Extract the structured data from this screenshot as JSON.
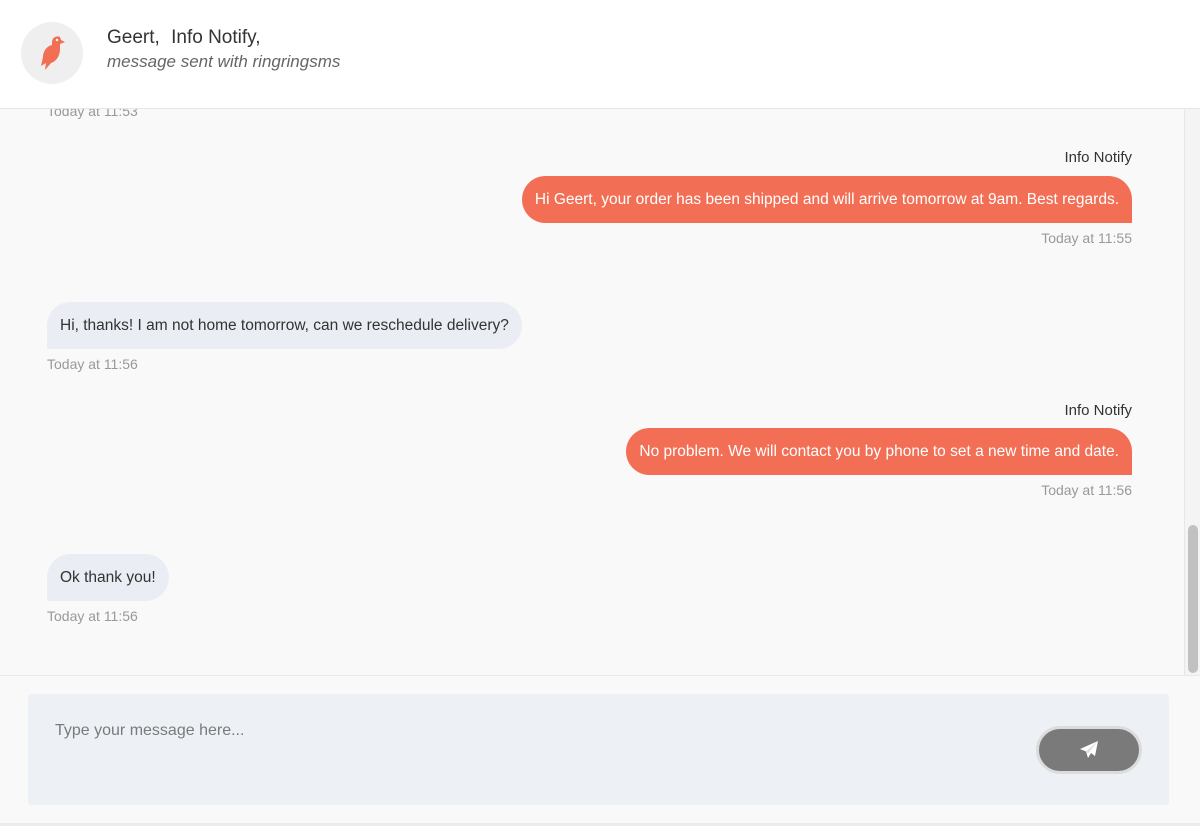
{
  "header": {
    "participants": [
      "Geert,",
      "Info Notify,"
    ],
    "subtitle": "message sent with ringringsms",
    "avatar_icon": "bird-icon",
    "brand_color": "#f26f55"
  },
  "conversation": {
    "top_partial_timestamp": "Today at 11:53",
    "messages": [
      {
        "direction": "out",
        "sender": "Info Notify",
        "text": "Hi Geert, your order has been shipped and will arrive tomorrow at 9am. Best regards.",
        "time": "Today at 11:55"
      },
      {
        "direction": "in",
        "text": "Hi, thanks! I am not home tomorrow, can we reschedule delivery?",
        "time": "Today at 11:56"
      },
      {
        "direction": "out",
        "sender": "Info Notify",
        "text": "No problem. We will contact you by phone to set a new time and date.",
        "time": "Today at 11:56"
      },
      {
        "direction": "in",
        "text": "Ok thank you!",
        "time": "Today at 11:56"
      }
    ]
  },
  "composer": {
    "placeholder": "Type your message here...",
    "value": "",
    "send_icon": "paper-plane-icon"
  }
}
